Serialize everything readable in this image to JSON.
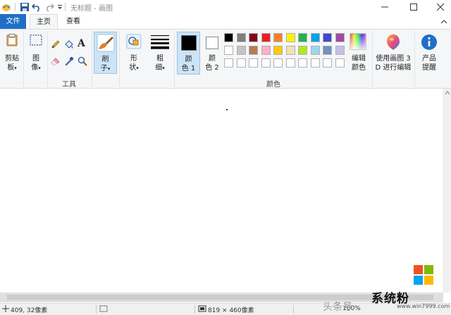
{
  "window": {
    "title": "无标题 - 画图",
    "controls": [
      "minimize",
      "maximize",
      "close"
    ]
  },
  "quick_access": [
    "paint-app-icon",
    "save-icon",
    "undo-icon",
    "redo-icon",
    "customize-quick-access-icon"
  ],
  "tabs": {
    "file": "文件",
    "home": "主页",
    "view": "查看"
  },
  "ribbon": {
    "clipboard": {
      "label_top": "剪贴",
      "label_bottom": "板"
    },
    "image": {
      "label_top": "图",
      "label_bottom": "像"
    },
    "tools_group": "工具",
    "tools": [
      "pencil-icon",
      "fill-bucket-icon",
      "text-icon",
      "eraser-icon",
      "color-picker-icon",
      "magnifier-icon"
    ],
    "brushes": {
      "label_top": "刷",
      "label_bottom": "子"
    },
    "shapes": {
      "label_top": "形",
      "label_bottom": "状"
    },
    "size": {
      "label_top": "粗",
      "label_bottom": "细"
    },
    "color1": {
      "label_top": "颜",
      "label_bottom": "色 1",
      "value": "#000000"
    },
    "color2": {
      "label_top": "颜",
      "label_bottom": "色 2",
      "value": "#ffffff"
    },
    "colors_group": "颜色",
    "palette_row1": [
      "#000000",
      "#7f7f7f",
      "#880015",
      "#ed1c24",
      "#ff7f27",
      "#fff200",
      "#22b14c",
      "#00a2e8",
      "#3f48cc",
      "#a349a4"
    ],
    "palette_row2": [
      "#ffffff",
      "#c3c3c3",
      "#b97a57",
      "#ffaec9",
      "#ffc90e",
      "#efe4b0",
      "#b5e61d",
      "#99d9ea",
      "#7092be",
      "#c8bfe7"
    ],
    "palette_row3": [
      "#ffffff",
      "#ffffff",
      "#ffffff",
      "#ffffff",
      "#ffffff",
      "#ffffff",
      "#ffffff",
      "#ffffff",
      "#ffffff",
      "#ffffff"
    ],
    "edit_colors": {
      "label_top": "编辑",
      "label_bottom": "颜色"
    },
    "paint3d": {
      "label_top": "使用画图 3",
      "label_bottom": "D 进行编辑"
    },
    "product_alert": {
      "label_top": "产品",
      "label_bottom": "提醒"
    }
  },
  "status": {
    "cursor_position": "409, 32像素",
    "image_size": "819 × 460像素",
    "zoom": "100%"
  },
  "watermarks": {
    "site_name": "系统粉",
    "site_url": "www.win7999.com",
    "toutiao": "头条号"
  }
}
